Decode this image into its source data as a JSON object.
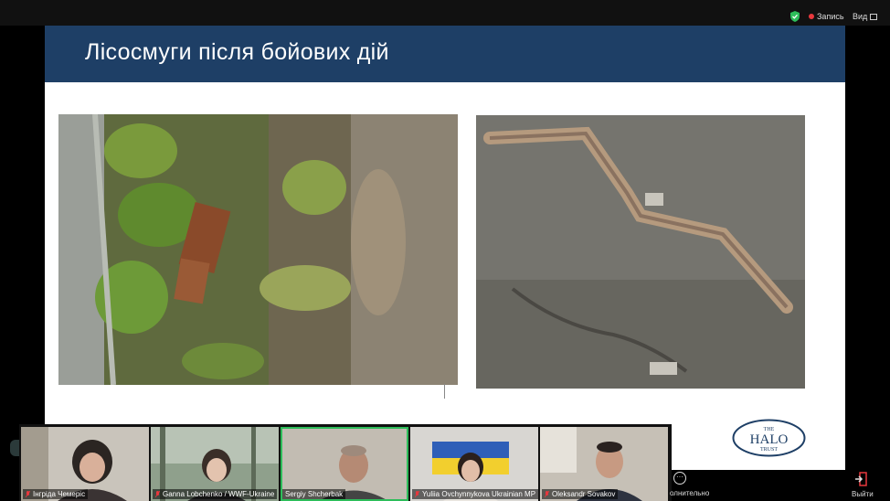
{
  "topbar": {
    "record_label": "Запись",
    "view_label": "Вид"
  },
  "slide": {
    "title": "Лісосмуги після бойових дій",
    "logo_the": "THE",
    "logo_halo": "HALO",
    "logo_trust": "TRUST"
  },
  "participants": [
    {
      "name": "Інгріда Чемеріс"
    },
    {
      "name": "Ganna Lobchenko / WWF-Ukraine"
    },
    {
      "name": "Sergiy Shcherbak"
    },
    {
      "name": "Yuliia Ovchynnykova Ukrainian MP"
    },
    {
      "name": "Oleksandr Sovakov"
    }
  ],
  "toolbar": {
    "more_label": "олнительно",
    "exit_label": "Выйти"
  },
  "colors": {
    "header_bg": "#1e3f66",
    "active_speaker": "#2dbd5a",
    "record_dot": "#e8383d"
  }
}
